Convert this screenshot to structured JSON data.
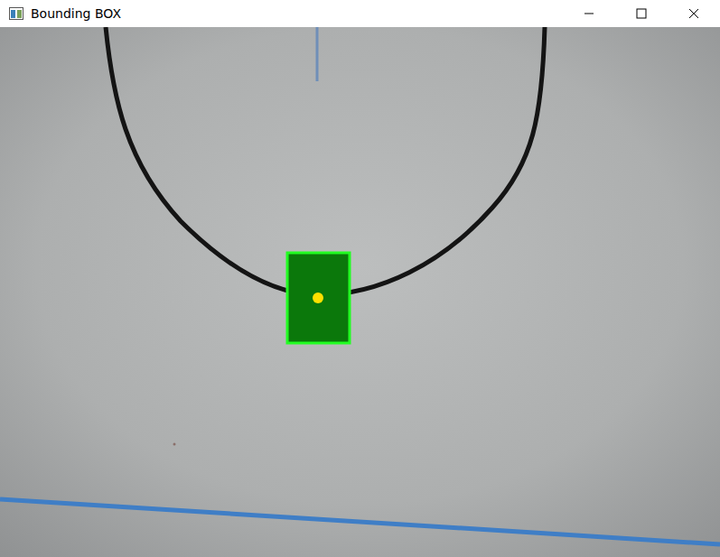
{
  "window": {
    "title": "Bounding BOX"
  }
}
